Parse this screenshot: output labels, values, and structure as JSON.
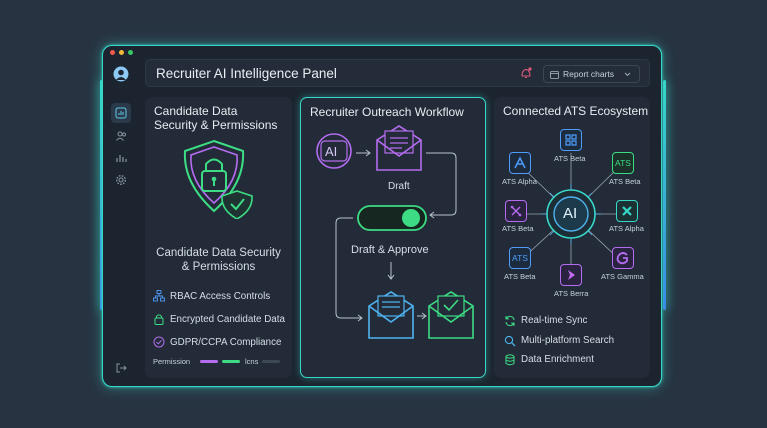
{
  "header": {
    "title": "Recruiter AI Intelligence Panel",
    "report_button": "Report charts"
  },
  "security_panel": {
    "title": "Candidate Data Security & Permissions",
    "subtitle": "Candidate Data Security & Permissions",
    "features": [
      {
        "label": "RBAC Access Controls"
      },
      {
        "label": "Encrypted Candidate Data"
      },
      {
        "label": "GDPR/CCPA Compliance"
      }
    ],
    "permission_label": "Permission",
    "permission_suffix": "lcns",
    "permission_levels": [
      0.38,
      0.28,
      0.22
    ]
  },
  "workflow_panel": {
    "title": "Recruiter Outreach Workflow",
    "ai_badge": "AI",
    "draft_label": "Draft",
    "toggle_label": "Draft & Approve",
    "toggle_on": true
  },
  "ats_panel": {
    "title": "Connected ATS Ecosystem",
    "hub_label": "AI",
    "nodes": [
      {
        "label": "ATS Beta"
      },
      {
        "label": "ATS Alpha"
      },
      {
        "label": "ATS Beta"
      },
      {
        "label": "ATS Beta"
      },
      {
        "label": "ATS Alpha"
      },
      {
        "label": "ATS Beta"
      },
      {
        "label": "ATS Gamma"
      },
      {
        "label": "ATS Berra"
      }
    ],
    "node_texts": [
      "ATS",
      "ATS"
    ],
    "features": [
      {
        "label": "Real-time Sync"
      },
      {
        "label": "Multi-platform Search"
      },
      {
        "label": "Data Enrichment"
      }
    ]
  },
  "colors": {
    "teal": "#38d8c8",
    "green": "#3ddc84",
    "purple": "#b46cf0",
    "blue": "#4f9cf9",
    "notification": "#e05a7a"
  }
}
